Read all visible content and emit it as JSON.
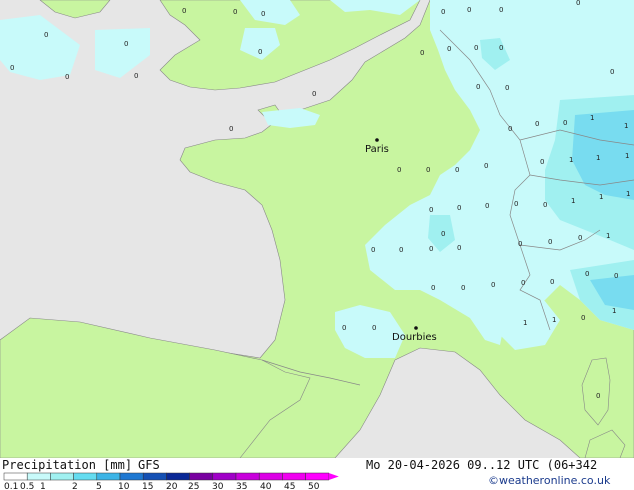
{
  "map": {
    "cities": [
      {
        "name": "Paris"
      },
      {
        "name": "Dourbies"
      }
    ],
    "grid_values": [
      "0",
      "1"
    ]
  },
  "legend": {
    "title": "Precipitation [mm]",
    "model": "GFS",
    "scale_labels": [
      "0.1",
      "0.5",
      "1",
      "2",
      "5",
      "10",
      "15",
      "20",
      "25",
      "30",
      "35",
      "40",
      "45",
      "50"
    ],
    "scale_colors": [
      "#ffffff",
      "#c8fafa",
      "#a0f0f0",
      "#64dcf0",
      "#3cb4e6",
      "#1e78d2",
      "#1450b4",
      "#0a2896",
      "#7800a0",
      "#a000c8",
      "#c800dc",
      "#dc00e6",
      "#f000f0",
      "#ff00ff"
    ]
  },
  "timestamp": "Mo 20-04-2026 09..12 UTC (06+342",
  "credit": "©weatheronline.co.uk",
  "colors": {
    "sea": "#e6e6e6",
    "land": "#c8f5a0",
    "precip_light": "#c8fafa",
    "precip_medium": "#a0f0f0",
    "precip_heavy": "#78dcf0"
  }
}
